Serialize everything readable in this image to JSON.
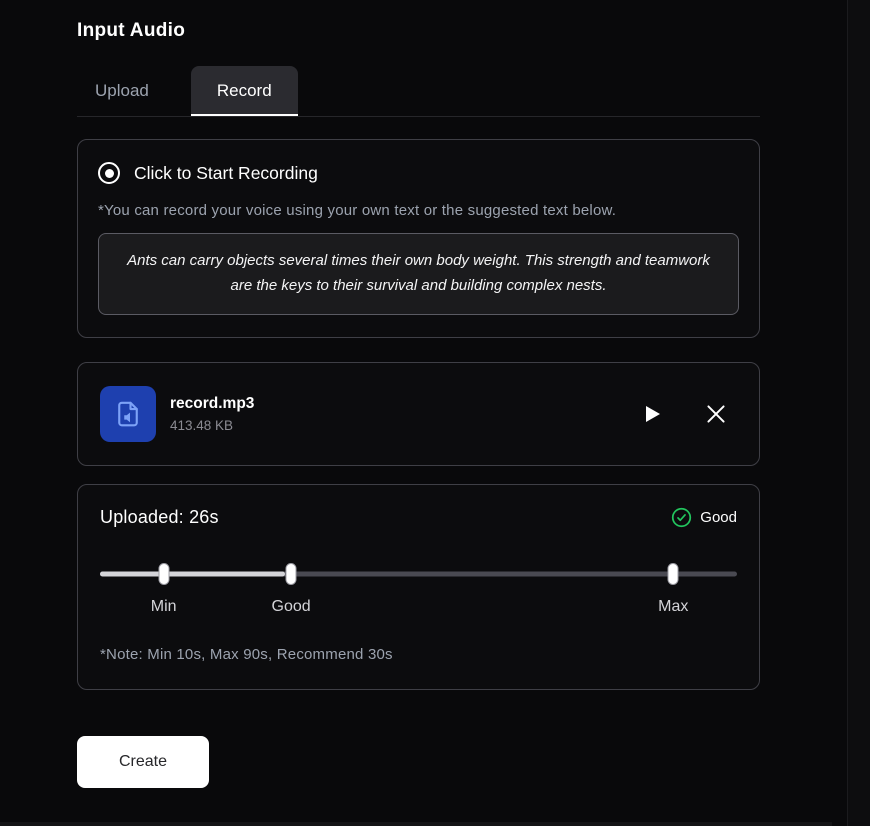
{
  "page": {
    "title": "Input Audio"
  },
  "tabs": [
    {
      "label": "Upload",
      "active": false
    },
    {
      "label": "Record",
      "active": true
    }
  ],
  "recording": {
    "start_label": "Click to Start Recording",
    "hint": "*You can record your voice using your own text or the suggested text below.",
    "suggested_text": "Ants can carry objects several times their own body weight. This strength and teamwork are the keys to their survival and building complex nests."
  },
  "file": {
    "name": "record.mp3",
    "size": "413.48 KB"
  },
  "duration": {
    "uploaded_label": "Uploaded: 26s",
    "status": "Good",
    "fill_pct": 29,
    "markers": [
      {
        "label": "Min",
        "position_pct": 10
      },
      {
        "label": "Good",
        "position_pct": 30
      },
      {
        "label": "Max",
        "position_pct": 90
      }
    ],
    "note": "*Note: Min 10s, Max 90s, Recommend 30s"
  },
  "actions": {
    "create_label": "Create"
  },
  "icons": {
    "record": "record-radio-icon",
    "audio_file": "audio-file-icon",
    "play": "play-icon",
    "close": "close-icon",
    "status_check": "check-circle-icon"
  },
  "colors": {
    "background": "#09090b",
    "card_border": "#3f3f46",
    "accent_blue": "#1e40af",
    "success_green": "#22c55e",
    "muted_text": "#9ca3af",
    "slider_fill": "#d4d4d8"
  }
}
